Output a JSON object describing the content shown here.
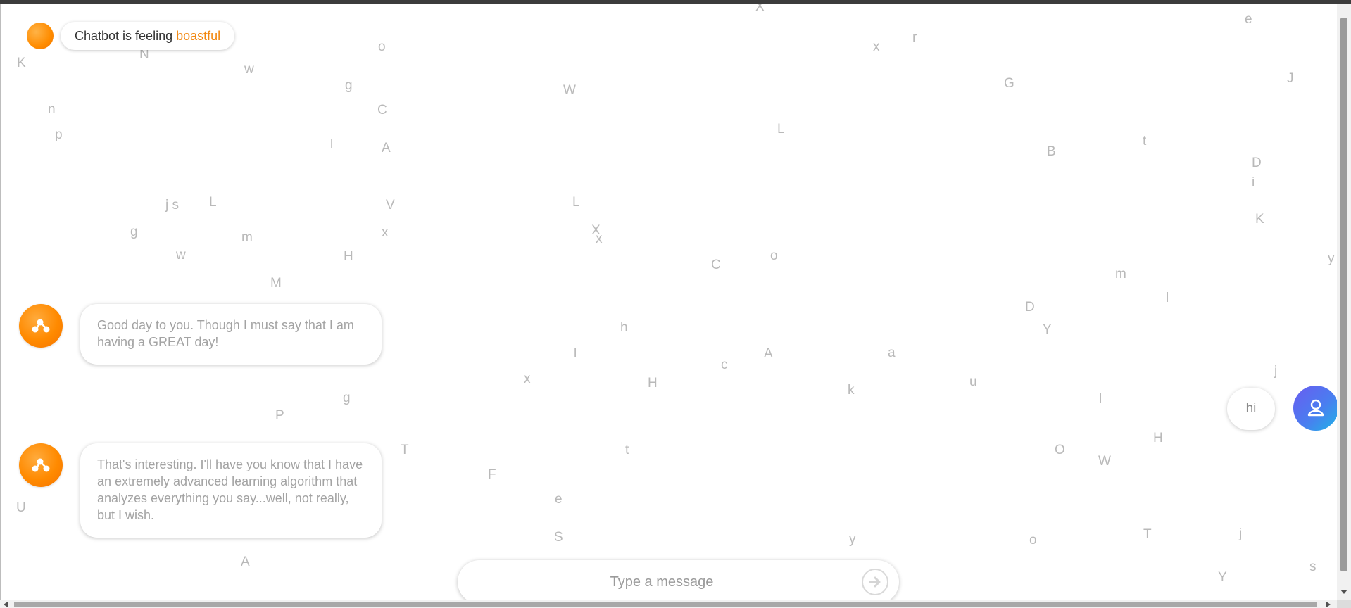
{
  "status": {
    "prefix": "Chatbot is feeling",
    "mood": "boastful"
  },
  "messages": [
    {
      "sender": "bot",
      "text": "Good day to you. Though I must say that I am having a GREAT day!"
    },
    {
      "sender": "user",
      "text": "hi"
    },
    {
      "sender": "bot",
      "text": "That's interesting. I'll have you know that I have an extremely advanced learning algorithm that analyzes everything you say...well, not really, but I wish."
    }
  ],
  "composer": {
    "placeholder": "Type a message"
  },
  "background_letters": [
    "X",
    "e",
    "K",
    "N",
    "o",
    "w",
    "x",
    "r",
    "J",
    "g",
    "W",
    "G",
    "n",
    "C",
    "L",
    "p",
    "l",
    "A",
    "t",
    "B",
    "D",
    "i",
    "j s",
    "L",
    "V",
    "L",
    "g",
    "x",
    "X",
    "x",
    "K",
    "m",
    "w",
    "H",
    "o",
    "C",
    "y",
    "M",
    "m",
    "l",
    "D",
    "h",
    "Y",
    "l",
    "A",
    "c",
    "a",
    "j",
    "x",
    "H",
    "k",
    "u",
    "l",
    "g",
    "P",
    "O",
    "W",
    "H",
    "T",
    "t",
    "F",
    "U",
    "e",
    "S",
    "y",
    "o",
    "T",
    "j",
    "s",
    "A",
    "Y"
  ],
  "colors": {
    "accent_orange": "#ff8c00",
    "user_gradient_start": "#6a5cf0",
    "user_gradient_end": "#1fb4e6",
    "bubble_text": "#a3a3a3",
    "background_letter": "#b9b9b9"
  },
  "icons": {
    "bot_avatar": "molecule-icon",
    "user_avatar": "user-icon",
    "send": "arrow-right-circle-icon"
  }
}
